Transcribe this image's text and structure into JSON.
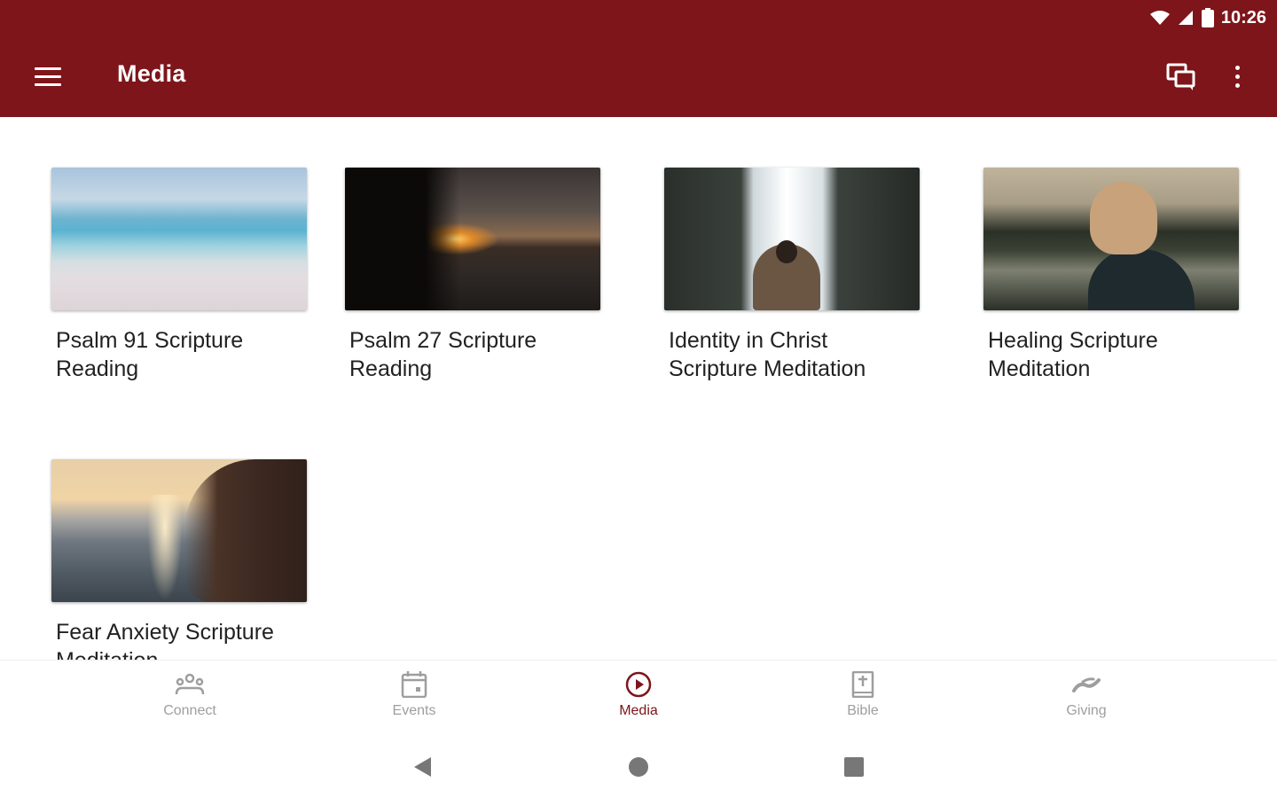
{
  "status_bar": {
    "time": "10:26"
  },
  "app_bar": {
    "title": "Media",
    "background": "#7d151a"
  },
  "media_items": [
    {
      "title": "Psalm 91 Scripture Reading"
    },
    {
      "title": "Psalm 27 Scripture Reading"
    },
    {
      "title": "Identity in Christ Scripture Meditation"
    },
    {
      "title": "Healing Scripture Meditation"
    },
    {
      "title": "Fear Anxiety Scripture Meditation"
    }
  ],
  "bottom_nav": {
    "active_color": "#7d151a",
    "items": [
      {
        "label": "Connect",
        "icon": "group-icon"
      },
      {
        "label": "Events",
        "icon": "calendar-icon"
      },
      {
        "label": "Media",
        "icon": "play-circle-icon",
        "active": true
      },
      {
        "label": "Bible",
        "icon": "bible-icon"
      },
      {
        "label": "Giving",
        "icon": "giving-hand-icon"
      }
    ]
  }
}
